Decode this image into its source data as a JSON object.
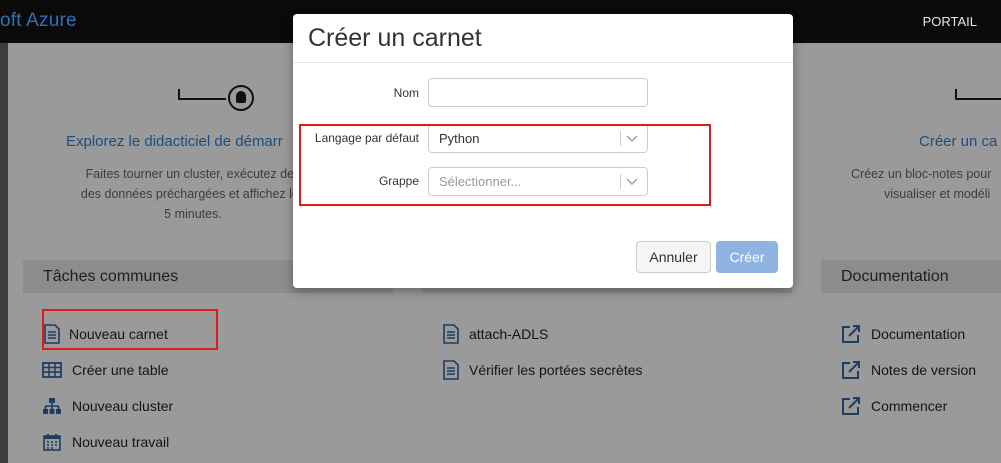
{
  "topbar": {
    "brand": "oft Azure",
    "portal_link": "PORTAIL"
  },
  "hero": {
    "left_link": "Explorez le didacticiel de démarr",
    "left_desc": [
      "Faites tourner un cluster, exécutez des",
      "des données préchargées et affichez les",
      "5 minutes."
    ],
    "right_link": "Créer un ca",
    "right_desc": [
      "Créez un bloc-notes pour",
      "visualiser et modéli"
    ]
  },
  "sections": {
    "common_tasks": "Tâches communes",
    "documentation": "Documentation"
  },
  "common_tasks": [
    {
      "label": "Nouveau carnet",
      "icon": "notebook-icon"
    },
    {
      "label": "Créer une table",
      "icon": "table-icon"
    },
    {
      "label": "Nouveau cluster",
      "icon": "cluster-icon"
    },
    {
      "label": "Nouveau travail",
      "icon": "calendar-icon"
    }
  ],
  "recents": [
    {
      "label": "attach-ADLS",
      "icon": "notebook-icon"
    },
    {
      "label": "Vérifier les portées secrètes",
      "icon": "notebook-icon"
    }
  ],
  "documentation": [
    {
      "label": "Documentation",
      "icon": "external-link-icon"
    },
    {
      "label": "Notes de version",
      "icon": "external-link-icon"
    },
    {
      "label": "Commencer",
      "icon": "external-link-icon"
    }
  ],
  "modal": {
    "title": "Créer un carnet",
    "name_label": "Nom",
    "name_value": "",
    "language_label": "Langage par défaut",
    "language_value": "Python",
    "cluster_label": "Grappe",
    "cluster_placeholder": "Sélectionner...",
    "cancel_label": "Annuler",
    "create_label": "Créer"
  },
  "colors": {
    "highlight_box": "#e01a1a",
    "brand": "#2a74b8",
    "create_button": "#8fb3e3"
  }
}
